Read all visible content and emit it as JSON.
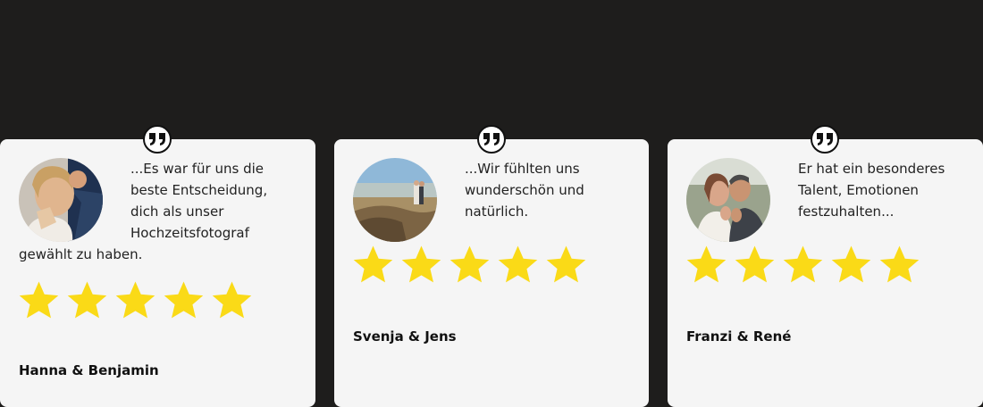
{
  "colors": {
    "background": "#1e1d1c",
    "card": "#f5f5f5",
    "star": "#fada17",
    "text": "#222222"
  },
  "rating_scale": 5,
  "testimonials": [
    {
      "quote": "...Es war für uns die beste Entscheidung, dich als unser Hochzeitsfotograf gewählt zu haben.",
      "author": "Hanna & Benjamin",
      "rating": 5,
      "photo": "bride-and-groom-portrait"
    },
    {
      "quote": "...Wir fühlten uns wunderschön und natürlich.",
      "author": "Svenja & Jens",
      "rating": 5,
      "photo": "couple-in-field-landscape"
    },
    {
      "quote": "Er hat ein besonderes Talent, Emotionen festzuhalten...",
      "author": "Franzi & René",
      "rating": 5,
      "photo": "couple-showing-rings"
    }
  ]
}
